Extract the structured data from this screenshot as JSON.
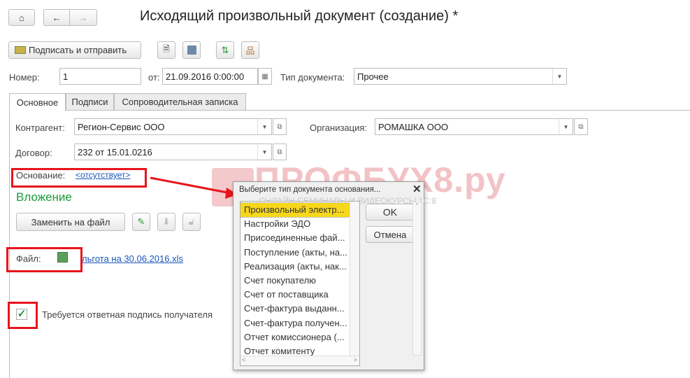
{
  "title": "Исходящий произвольный документ (создание) *",
  "toolbar": {
    "sign_send": "Подписать и отправить"
  },
  "header": {
    "number_label": "Номер:",
    "number": "1",
    "date_label": "от:",
    "date": "21.09.2016  0:00:00",
    "type_label": "Тип документа:",
    "type": "Прочее"
  },
  "tabs": [
    "Основное",
    "Подписи",
    "Сопроводительная записка"
  ],
  "main": {
    "counterparty_label": "Контрагент:",
    "counterparty": "Регион-Сервис  ООО",
    "org_label": "Организация:",
    "org": "РОМАШКА ООО",
    "contract_label": "Договор:",
    "contract": "232 от 15.01.0216",
    "basis_label": "Основание:",
    "basis_link": "<отсутствует>",
    "attachment_heading": "Вложение",
    "replace_file": "Заменить на файл",
    "file_label": "Файл:",
    "file_link": "льгота на 30.06.2016.xls",
    "require_sign": "Требуется ответная подпись получателя",
    "require_sign_checked": true
  },
  "dialog": {
    "title": "Выберите тип документа основания...",
    "ok": "OK",
    "cancel": "Отмена",
    "items": [
      "Произвольный электр...",
      "Настройки ЭДО",
      "Присоединенные фай...",
      "Поступление (акты, на...",
      "Реализация (акты, нак...",
      "Счет покупателю",
      "Счет от поставщика",
      "Счет-фактура выданн...",
      "Счет-фактура получен...",
      "Отчет комиссионера (...",
      "Отчет комитенту"
    ],
    "selected_index": 0
  },
  "watermark": {
    "brand": "ПРОФБУХ8.ру",
    "tagline": "ОНЛАЙН-СЕМИНАРЫ И ВИДЕОКУРСЫ 1С:8"
  },
  "colors": {
    "accent_green": "#1a9a3a",
    "highlight": "#f7d71c",
    "annotation_red": "#e8141b"
  }
}
